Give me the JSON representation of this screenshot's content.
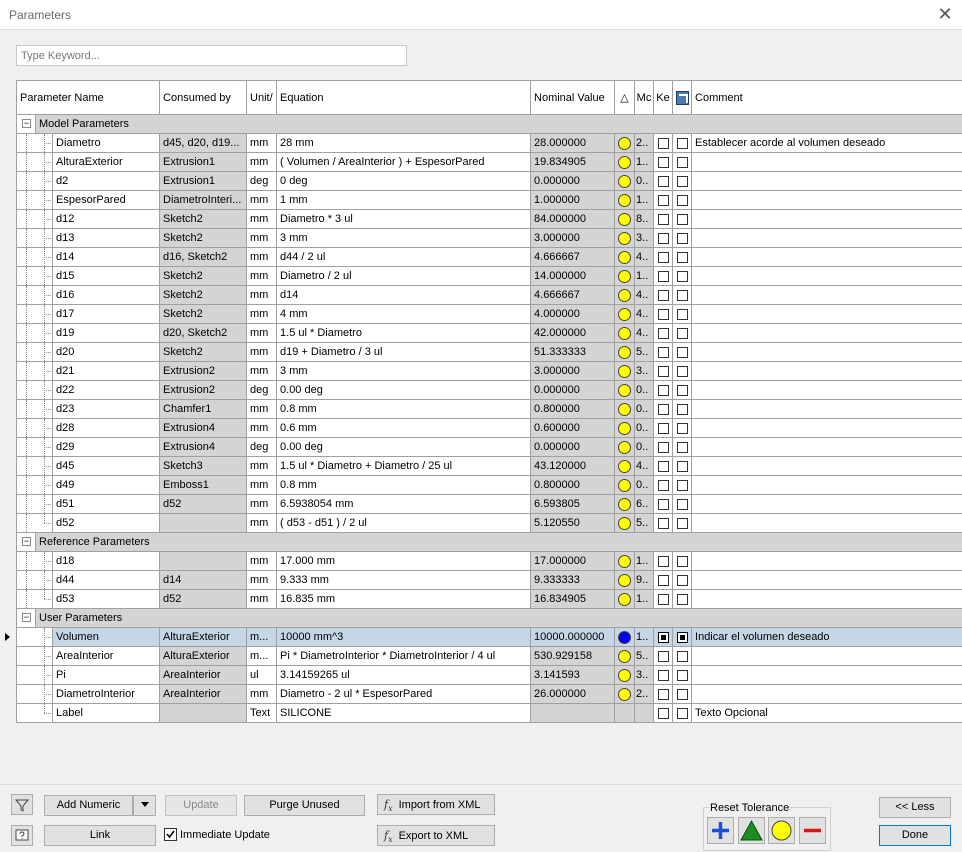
{
  "window": {
    "title": "Parameters",
    "close_glyph": "✕"
  },
  "search": {
    "placeholder": "Type Keyword..."
  },
  "columns": {
    "name": "Parameter Name",
    "consumed": "Consumed by",
    "unit": "Unit/",
    "equation": "Equation",
    "nominal": "Nominal Value",
    "tolerance": "△",
    "model": "Mc",
    "key": "Ke",
    "comment": "Comment"
  },
  "groups": {
    "model": "Model Parameters",
    "reference": "Reference Parameters",
    "user": "User Parameters"
  },
  "model_rows": [
    {
      "name": "Diametro",
      "consumed": "d45, d20, d19...",
      "unit": "mm",
      "equation": "28 mm",
      "nominal": "28.000000",
      "model": "2..",
      "comment": "Establecer acorde al volumen deseado"
    },
    {
      "name": "AlturaExterior",
      "consumed": "Extrusion1",
      "unit": "mm",
      "equation": "( Volumen / AreaInterior ) + EspesorPared",
      "nominal": "19.834905",
      "model": "1..",
      "comment": ""
    },
    {
      "name": "d2",
      "consumed": "Extrusion1",
      "unit": "deg",
      "equation": "0 deg",
      "nominal": "0.000000",
      "model": "0..",
      "comment": ""
    },
    {
      "name": "EspesorPared",
      "consumed": "DiametroInteri...",
      "unit": "mm",
      "equation": "1 mm",
      "nominal": "1.000000",
      "model": "1..",
      "comment": ""
    },
    {
      "name": "d12",
      "consumed": "Sketch2",
      "unit": "mm",
      "equation": "Diametro * 3 ul",
      "nominal": "84.000000",
      "model": "8..",
      "comment": ""
    },
    {
      "name": "d13",
      "consumed": "Sketch2",
      "unit": "mm",
      "equation": "3 mm",
      "nominal": "3.000000",
      "model": "3..",
      "comment": ""
    },
    {
      "name": "d14",
      "consumed": "d16, Sketch2",
      "unit": "mm",
      "equation": "d44 / 2 ul",
      "nominal": "4.666667",
      "model": "4..",
      "comment": ""
    },
    {
      "name": "d15",
      "consumed": "Sketch2",
      "unit": "mm",
      "equation": "Diametro / 2 ul",
      "nominal": "14.000000",
      "model": "1..",
      "comment": ""
    },
    {
      "name": "d16",
      "consumed": "Sketch2",
      "unit": "mm",
      "equation": "d14",
      "nominal": "4.666667",
      "model": "4..",
      "comment": ""
    },
    {
      "name": "d17",
      "consumed": "Sketch2",
      "unit": "mm",
      "equation": "4 mm",
      "nominal": "4.000000",
      "model": "4..",
      "comment": ""
    },
    {
      "name": "d19",
      "consumed": "d20, Sketch2",
      "unit": "mm",
      "equation": "1.5 ul * Diametro",
      "nominal": "42.000000",
      "model": "4..",
      "comment": ""
    },
    {
      "name": "d20",
      "consumed": "Sketch2",
      "unit": "mm",
      "equation": "d19 + Diametro / 3 ul",
      "nominal": "51.333333",
      "model": "5..",
      "comment": ""
    },
    {
      "name": "d21",
      "consumed": "Extrusion2",
      "unit": "mm",
      "equation": "3 mm",
      "nominal": "3.000000",
      "model": "3..",
      "comment": ""
    },
    {
      "name": "d22",
      "consumed": "Extrusion2",
      "unit": "deg",
      "equation": "0.00 deg",
      "nominal": "0.000000",
      "model": "0..",
      "comment": ""
    },
    {
      "name": "d23",
      "consumed": "Chamfer1",
      "unit": "mm",
      "equation": "0.8 mm",
      "nominal": "0.800000",
      "model": "0..",
      "comment": ""
    },
    {
      "name": "d28",
      "consumed": "Extrusion4",
      "unit": "mm",
      "equation": "0.6 mm",
      "nominal": "0.600000",
      "model": "0..",
      "comment": ""
    },
    {
      "name": "d29",
      "consumed": "Extrusion4",
      "unit": "deg",
      "equation": "0.00 deg",
      "nominal": "0.000000",
      "model": "0..",
      "comment": ""
    },
    {
      "name": "d45",
      "consumed": "Sketch3",
      "unit": "mm",
      "equation": "1.5 ul * Diametro + Diametro / 25 ul",
      "nominal": "43.120000",
      "model": "4..",
      "comment": ""
    },
    {
      "name": "d49",
      "consumed": "Emboss1",
      "unit": "mm",
      "equation": "0.8 mm",
      "nominal": "0.800000",
      "model": "0..",
      "comment": ""
    },
    {
      "name": "d51",
      "consumed": "d52",
      "unit": "mm",
      "equation": "6.5938054 mm",
      "nominal": "6.593805",
      "model": "6..",
      "comment": ""
    },
    {
      "name": "d52",
      "consumed": "",
      "unit": "mm",
      "equation": "( d53 - d51 ) / 2 ul",
      "nominal": "5.120550",
      "model": "5..",
      "comment": ""
    }
  ],
  "reference_rows": [
    {
      "name": "d18",
      "consumed": "",
      "unit": "mm",
      "equation": "17.000 mm",
      "nominal": "17.000000",
      "model": "1..",
      "comment": ""
    },
    {
      "name": "d44",
      "consumed": "d14",
      "unit": "mm",
      "equation": "9.333 mm",
      "nominal": "9.333333",
      "model": "9..",
      "comment": ""
    },
    {
      "name": "d53",
      "consumed": "d52",
      "unit": "mm",
      "equation": "16.835 mm",
      "nominal": "16.834905",
      "model": "1..",
      "comment": ""
    }
  ],
  "user_rows": [
    {
      "name": "Volumen",
      "consumed": "AlturaExterior",
      "unit": "m...",
      "equation": "10000 mm^3",
      "nominal": "10000.000000",
      "model": "1..",
      "comment": "Indicar el volumen deseado",
      "selected": true
    },
    {
      "name": "AreaInterior",
      "consumed": "AlturaExterior",
      "unit": "m...",
      "equation": "Pi * DiametroInterior * DiametroInterior / 4 ul",
      "nominal": "530.929158",
      "model": "5..",
      "comment": ""
    },
    {
      "name": "Pi",
      "consumed": "AreaInterior",
      "unit": "ul",
      "equation": "3.14159265 ul",
      "nominal": "3.141593",
      "model": "3..",
      "comment": ""
    },
    {
      "name": "DiametroInterior",
      "consumed": "AreaInterior",
      "unit": "mm",
      "equation": "Diametro - 2 ul * EspesorPared",
      "nominal": "26.000000",
      "model": "2..",
      "comment": ""
    },
    {
      "name": "Label",
      "consumed": "",
      "unit": "Text",
      "equation": "SILICONE",
      "nominal": "",
      "model": "",
      "comment": "Texto Opcional",
      "text_row": true
    }
  ],
  "buttons": {
    "add_numeric": "Add Numeric",
    "update": "Update",
    "purge": "Purge Unused",
    "import_xml": "Import from XML",
    "export_xml": "Export to XML",
    "link": "Link",
    "immediate_update": "Immediate Update",
    "less": "<< Less",
    "done": "Done",
    "reset_tolerance": "Reset Tolerance"
  },
  "colors": {
    "status_ok": "#ffff00",
    "status_selected": "#0000ee",
    "tol_plus": "#1f4fd0",
    "tol_up": "#1e8c1e",
    "tol_mid": "#ffff00",
    "tol_minus": "#d01818"
  }
}
